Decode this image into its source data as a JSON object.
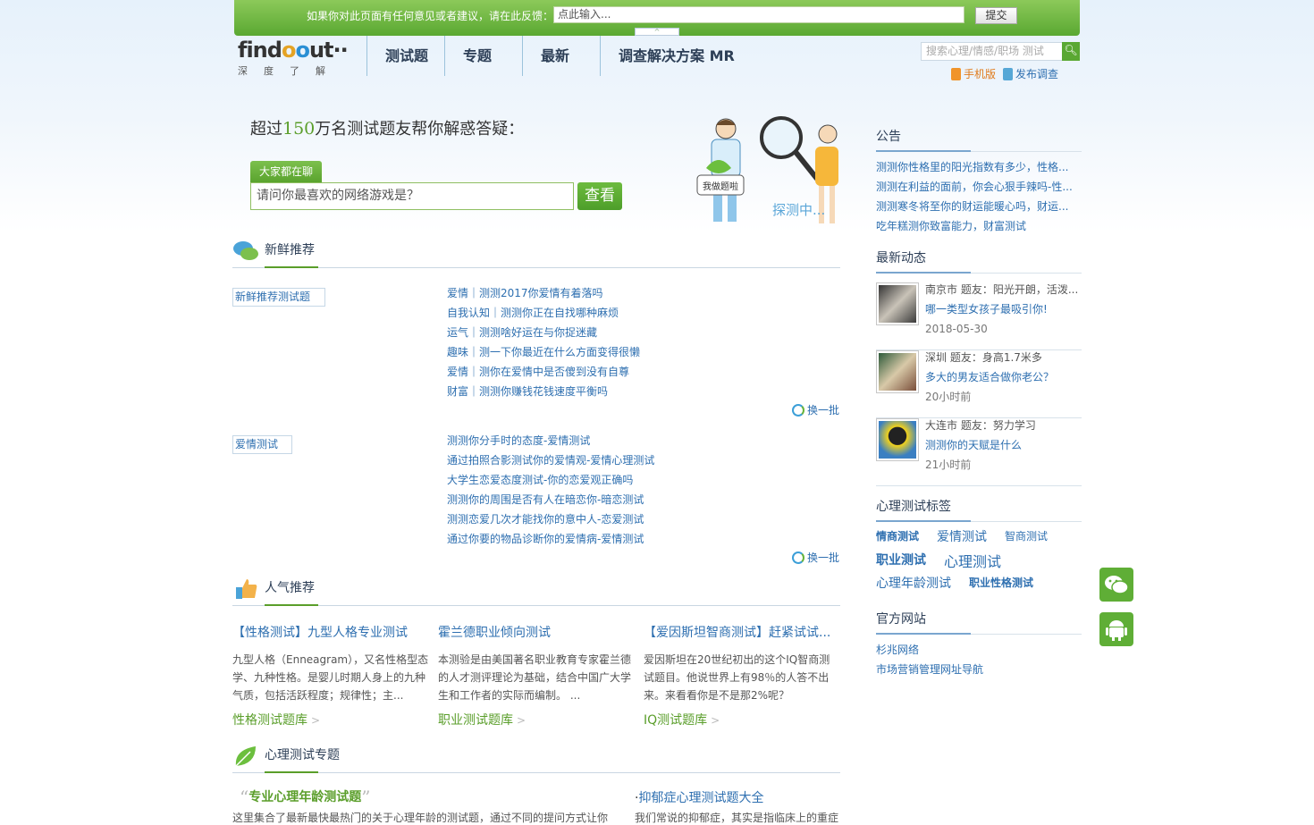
{
  "feedback": {
    "label": "如果你对此页面有任何意见或者建议，请在此反馈：",
    "placeholder": "点此输入...",
    "submit": "提交",
    "toggle": "^"
  },
  "logo": {
    "word_a": "find",
    "word_b": "o",
    "word_c": "o",
    "word_d": "ut",
    "dots": "··",
    "slogan": "深度了解"
  },
  "nav": [
    "测试题",
    "专题",
    "最新",
    "调查解决方案 MR"
  ],
  "search": {
    "placeholder": "搜索心理/情感/职场 测试"
  },
  "toplinks": {
    "mobile": "手机版",
    "survey": "发布调查"
  },
  "hero": {
    "pre": "超过",
    "num": "150",
    "post": "万名测试题友帮你解惑答疑："
  },
  "chat": {
    "tag": "大家都在聊",
    "question": "请问你最喜欢的网络游戏是？",
    "button": "查看"
  },
  "fresh": {
    "title": "新鲜推荐",
    "img1_alt": "新鲜推荐测试题",
    "list1": [
      "爱情｜测测2017你爱情有着落吗",
      "自我认知｜测测你正在自找哪种麻烦",
      "运气｜测测啥好运在与你捉迷藏",
      "趣味｜测一下你最近在什么方面变得很懒",
      "爱情｜测你在爱情中是否傻到没有自尊",
      "财富｜测测你赚钱花钱速度平衡吗"
    ],
    "swap": "换一批",
    "img2_alt": "爱情测试",
    "list2": [
      "测测你分手时的态度-爱情测试",
      "通过拍照合影测试你的爱情观-爱情心理测试",
      "大学生恋爱态度测试-你的恋爱观正确吗",
      "测测你的周围是否有人在暗恋你-暗恋测试",
      "测测恋爱几次才能找你的意中人-恋爱测试",
      "通过你要的物品诊断你的爱情病-爱情测试"
    ]
  },
  "popular": {
    "title": "人气推荐",
    "cards": [
      {
        "title": "【性格测试】九型人格专业测试",
        "desc": "九型人格（Enneagram），又名性格型态学、九种性格。是婴儿时期人身上的九种气质，包括活跃程度；规律性；主...",
        "lib": "性格测试题库",
        "arrow": ">"
      },
      {
        "title": "霍兰德职业倾向测试",
        "desc": "本测验是由美国著名职业教育专家霍兰德的人才测评理论为基础，结合中国广大学生和工作者的实际而编制。 ...",
        "lib": "职业测试题库",
        "arrow": ">"
      },
      {
        "title": "【爱因斯坦智商测试】赶紧试试...",
        "desc": "爱因斯坦在20世纪初出的这个IQ智商测试题目。他说世界上有98％的人答不出来。来看看你是不是那2%呢？",
        "lib": "IQ测试题库",
        "arrow": ">"
      }
    ]
  },
  "topics": {
    "title": "心理测试专题",
    "t1_qo": "“",
    "t1": "专业心理年龄测试题",
    "t1_qc": "”",
    "t1_desc": "这里集合了最新最快最热门的关于心理年龄的测试题，通过不同的提问方式让你",
    "t2_bullet": "·",
    "t2": "抑郁症心理测试题大全",
    "t2_desc": "我们常说的抑郁症，其实是指临床上的重症"
  },
  "notice": {
    "title": "公告",
    "items": [
      "测测你性格里的阳光指数有多少，性格...",
      "测测在利益的面前，你会心狠手辣吗-性...",
      "测测寒冬将至你的财运能暖心吗，财运...",
      "吃年糕测你致富能力，财富测试"
    ]
  },
  "feed": {
    "title": "最新动态",
    "items": [
      {
        "who": "南京市 题友：阳光开朗，活泼...",
        "what": "哪一类型女孩子最吸引你!",
        "when": "2018-05-30"
      },
      {
        "who": "深圳 题友：身高1.7米多",
        "what": "多大的男友适合做你老公？",
        "when": "20小时前"
      },
      {
        "who": "大连市 题友：努力学习",
        "what": "测测你的天赋是什么",
        "when": "21小时前"
      }
    ]
  },
  "tags": {
    "title": "心理测试标签",
    "items": [
      "情商测试",
      "爱情测试",
      "智商测试",
      "职业测试",
      "心理测试",
      "心理年龄测试",
      "职业性格测试"
    ]
  },
  "official": {
    "title": "官方网站",
    "items": [
      "杉兆网络",
      "市场营销管理网址导航"
    ]
  },
  "colors": {
    "brand_green": "#5aa832",
    "link_blue": "#2e6fb0",
    "nav_text": "#2d3f57"
  }
}
